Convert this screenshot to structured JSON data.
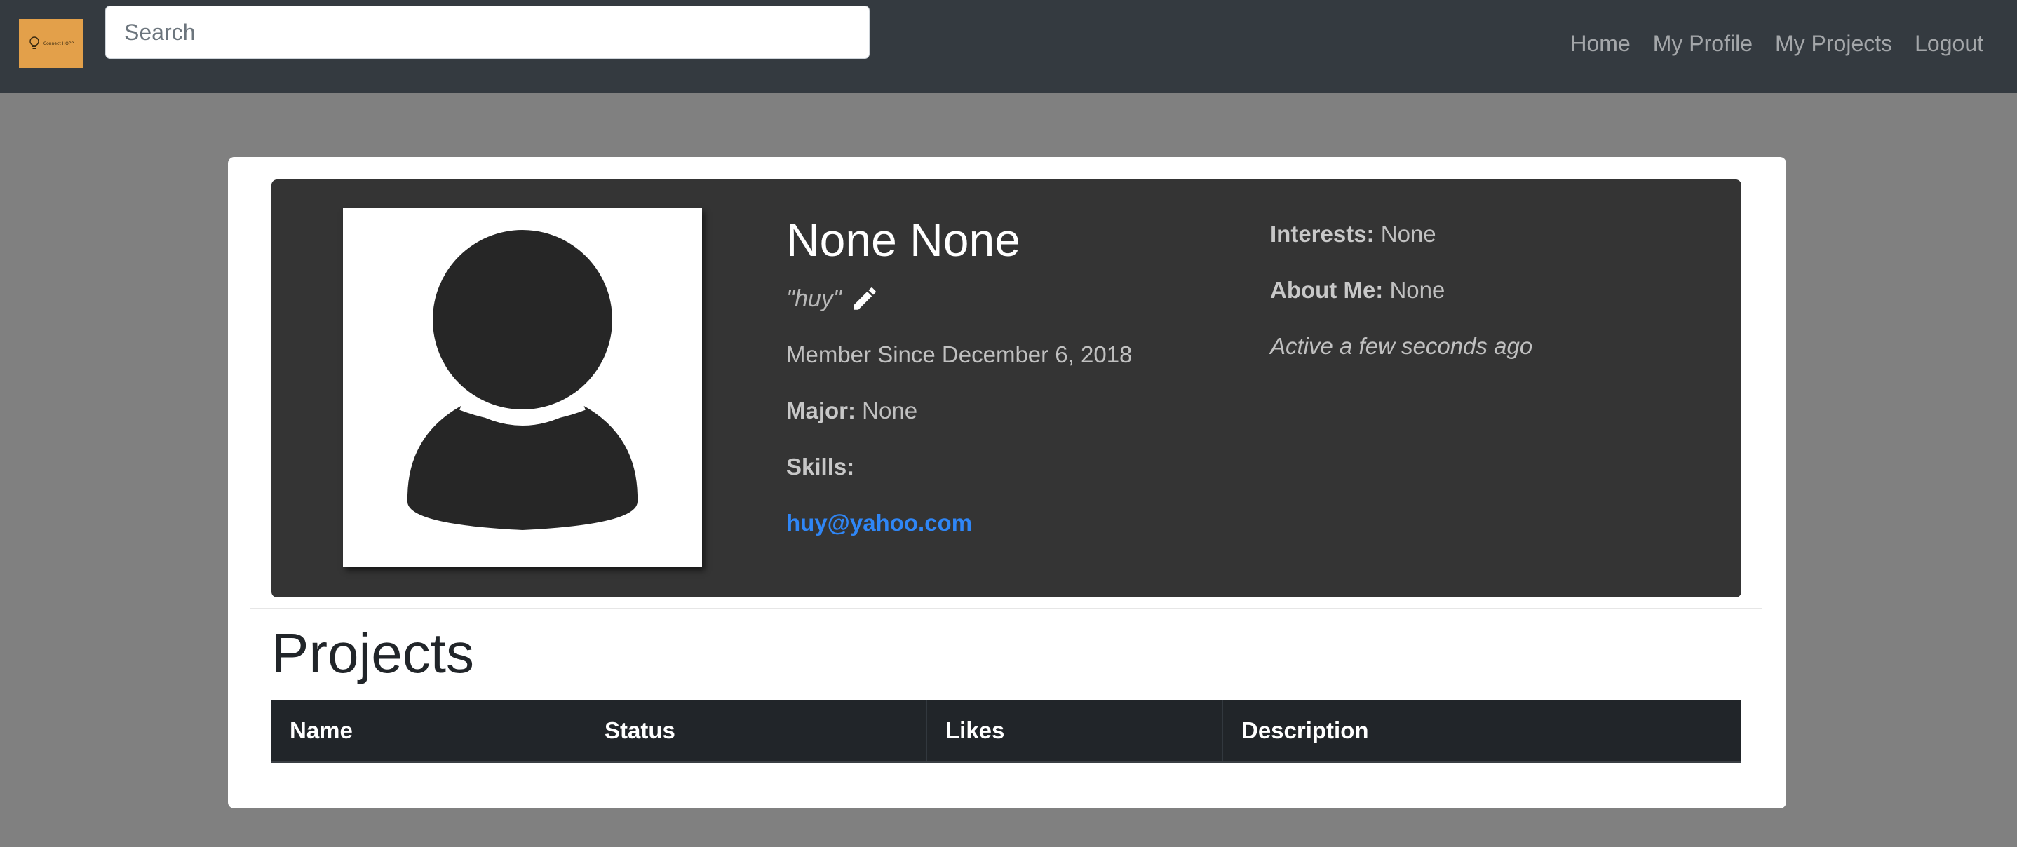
{
  "navbar": {
    "brand_text": "Connect HOPP",
    "search": {
      "placeholder": "Search",
      "value": ""
    },
    "links": [
      {
        "label": "Home"
      },
      {
        "label": "My Profile"
      },
      {
        "label": "My Projects"
      },
      {
        "label": "Logout"
      }
    ]
  },
  "profile": {
    "name": "None None",
    "nickname": "\"huy\"",
    "member_since": "Member Since December 6, 2018",
    "major_label": "Major:",
    "major_value": " None",
    "skills_label": "Skills:",
    "skills_value": "",
    "email": "huy@yahoo.com",
    "interests_label": "Interests:",
    "interests_value": " None",
    "about_label": "About Me:",
    "about_value": " None",
    "active_status": "Active a few seconds ago"
  },
  "projects": {
    "heading": "Projects",
    "columns": [
      "Name",
      "Status",
      "Likes",
      "Description"
    ],
    "rows": []
  },
  "icons": {
    "brand": "lightbulb-icon",
    "avatar": "user-silhouette-icon",
    "edit": "pencil-icon"
  },
  "colors": {
    "navbar_bg": "#343a40",
    "page_bg": "#808080",
    "profile_panel_bg": "#343434",
    "brand_bg": "#e3a04a",
    "link": "#2f86f6",
    "table_header_bg": "#212529"
  }
}
